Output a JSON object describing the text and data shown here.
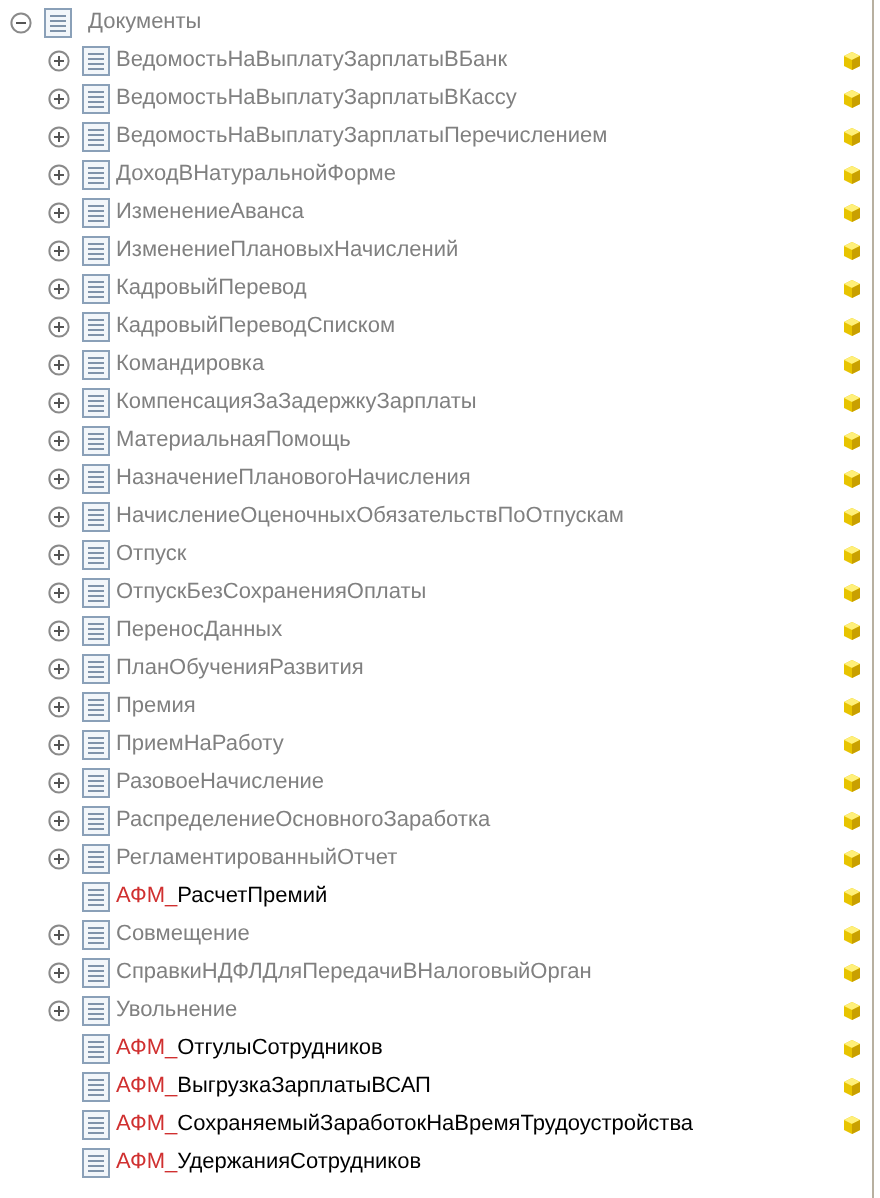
{
  "tree": {
    "label": "Документы",
    "expanded": true,
    "children": [
      {
        "kind": "standard",
        "label": "ВедомостьНаВыплатуЗарплатыВБанк",
        "expandable": true,
        "supported": true
      },
      {
        "kind": "standard",
        "label": "ВедомостьНаВыплатуЗарплатыВКассу",
        "expandable": true,
        "supported": true
      },
      {
        "kind": "standard",
        "label": "ВедомостьНаВыплатуЗарплатыПеречислением",
        "expandable": true,
        "supported": true
      },
      {
        "kind": "standard",
        "label": "ДоходВНатуральнойФорме",
        "expandable": true,
        "supported": true
      },
      {
        "kind": "standard",
        "label": "ИзменениеАванса",
        "expandable": true,
        "supported": true
      },
      {
        "kind": "standard",
        "label": "ИзменениеПлановыхНачислений",
        "expandable": true,
        "supported": true
      },
      {
        "kind": "standard",
        "label": "КадровыйПеревод",
        "expandable": true,
        "supported": true
      },
      {
        "kind": "standard",
        "label": "КадровыйПереводСписком",
        "expandable": true,
        "supported": true
      },
      {
        "kind": "standard",
        "label": "Командировка",
        "expandable": true,
        "supported": true
      },
      {
        "kind": "standard",
        "label": "КомпенсацияЗаЗадержкуЗарплаты",
        "expandable": true,
        "supported": true
      },
      {
        "kind": "standard",
        "label": "МатериальнаяПомощь",
        "expandable": true,
        "supported": true
      },
      {
        "kind": "standard",
        "label": "НазначениеПлановогоНачисления",
        "expandable": true,
        "supported": true
      },
      {
        "kind": "standard",
        "label": "НачислениеОценочныхОбязательствПоОтпускам",
        "expandable": true,
        "supported": true
      },
      {
        "kind": "standard",
        "label": "Отпуск",
        "expandable": true,
        "supported": true
      },
      {
        "kind": "standard",
        "label": "ОтпускБезСохраненияОплаты",
        "expandable": true,
        "supported": true
      },
      {
        "kind": "standard",
        "label": "ПереносДанных",
        "expandable": true,
        "supported": true
      },
      {
        "kind": "standard",
        "label": "ПланОбученияРазвития",
        "expandable": true,
        "supported": true
      },
      {
        "kind": "standard",
        "label": "Премия",
        "expandable": true,
        "supported": true
      },
      {
        "kind": "standard",
        "label": "ПриемНаРаботу",
        "expandable": true,
        "supported": true
      },
      {
        "kind": "standard",
        "label": "РазовоеНачисление",
        "expandable": true,
        "supported": true
      },
      {
        "kind": "standard",
        "label": "РаспределениеОсновногоЗаработка",
        "expandable": true,
        "supported": true
      },
      {
        "kind": "standard",
        "label": "РегламентированныйОтчет",
        "expandable": true,
        "supported": true
      },
      {
        "kind": "custom",
        "prefix": "АФМ_",
        "label": "РасчетПремий",
        "expandable": false,
        "supported": true
      },
      {
        "kind": "standard",
        "label": "Совмещение",
        "expandable": true,
        "supported": true
      },
      {
        "kind": "standard",
        "label": "СправкиНДФЛДляПередачиВНалоговыйОрган",
        "expandable": true,
        "supported": true
      },
      {
        "kind": "standard",
        "label": "Увольнение",
        "expandable": true,
        "supported": true
      },
      {
        "kind": "custom",
        "prefix": "АФМ_",
        "label": "ОтгулыСотрудников",
        "expandable": false,
        "supported": true
      },
      {
        "kind": "custom",
        "prefix": "АФМ_",
        "label": "ВыгрузкаЗарплатыВСАП",
        "expandable": false,
        "supported": true
      },
      {
        "kind": "custom",
        "prefix": "АФМ_",
        "label": "СохраняемыйЗаработокНаВремяТрудоустройства",
        "expandable": false,
        "supported": true
      },
      {
        "kind": "custom",
        "prefix": "АФМ_",
        "label": "УдержанияСотрудников",
        "expandable": false,
        "supported": false
      }
    ]
  }
}
